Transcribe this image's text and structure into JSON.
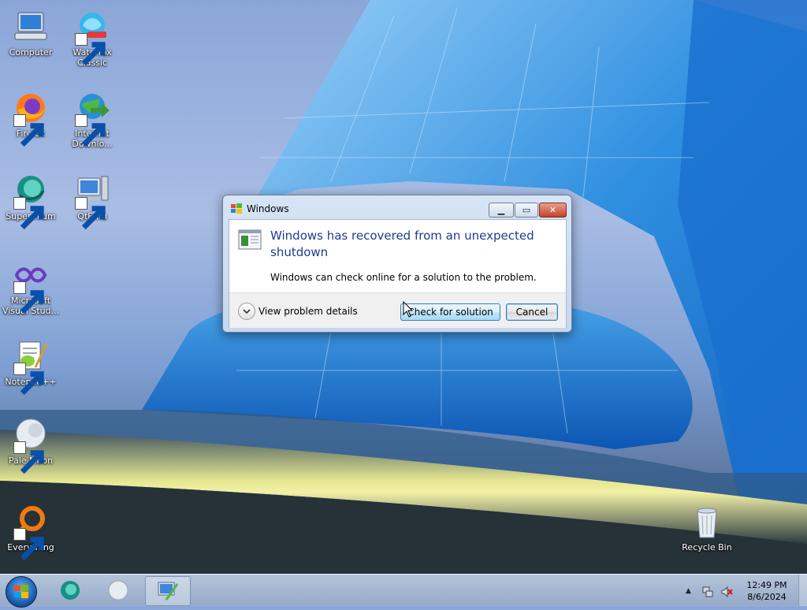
{
  "desktop": {
    "icons": [
      {
        "label": "Computer",
        "icon": "computer-icon"
      },
      {
        "label": "Waterfox Classic",
        "icon": "waterfox-icon"
      },
      {
        "label": "Firefox",
        "icon": "firefox-icon"
      },
      {
        "label": "Internet Downlo...",
        "icon": "internet-download-manager-icon"
      },
      {
        "label": "Supermium",
        "icon": "supermium-icon"
      },
      {
        "label": "QtEmu",
        "icon": "qtemu-icon"
      },
      {
        "label": "Microsoft Visual Stud...",
        "icon": "visual-studio-icon"
      },
      {
        "label": "Notepad++",
        "icon": "notepadpp-icon"
      },
      {
        "label": "Pale Moon",
        "icon": "pale-moon-icon"
      },
      {
        "label": "Everything",
        "icon": "everything-icon"
      },
      {
        "label": "Recycle Bin",
        "icon": "recycle-bin-icon"
      }
    ]
  },
  "dialog": {
    "title": "Windows",
    "heading": "Windows has recovered from an unexpected shutdown",
    "subtext": "Windows can check online for a solution to the problem.",
    "details_label": "View problem details",
    "check_button": "Check for solution",
    "cancel_button": "Cancel",
    "close_glyph": "✕",
    "min_glyph": "▁",
    "max_glyph": "▭"
  },
  "taskbar": {
    "time": "12:49 PM",
    "date": "8/6/2024",
    "tray_arrow": "▲",
    "apps": [
      "supermium-icon",
      "pale-moon-icon",
      "qtemu-icon"
    ]
  },
  "colors": {
    "heading": "#1e3c8c",
    "accent": "#3c7fb1"
  }
}
